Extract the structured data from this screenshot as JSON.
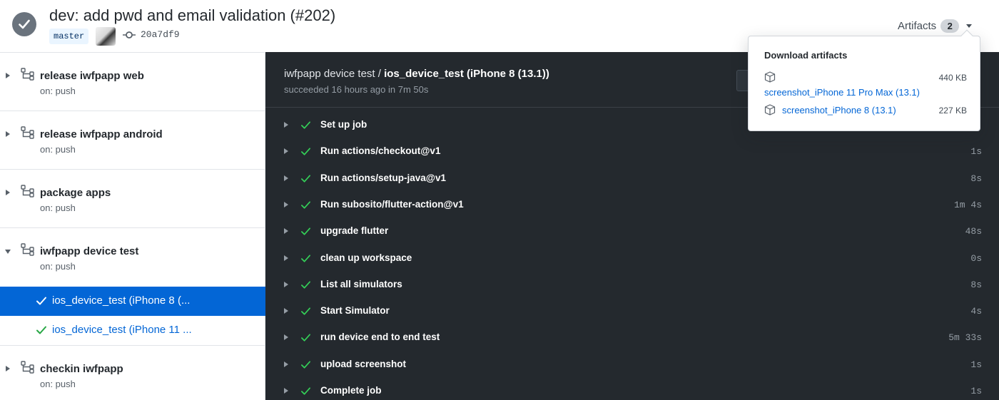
{
  "header": {
    "title": "dev: add pwd and email validation (#202)",
    "branch": "master",
    "commit_sha": "20a7df9",
    "artifacts_label": "Artifacts",
    "artifacts_count": "2"
  },
  "sidebar": {
    "workflows": [
      {
        "name": "release iwfpapp web",
        "trigger": "on: push",
        "expanded": false
      },
      {
        "name": "release iwfpapp android",
        "trigger": "on: push",
        "expanded": false
      },
      {
        "name": "package apps",
        "trigger": "on: push",
        "expanded": false
      },
      {
        "name": "iwfpapp device test",
        "trigger": "on: push",
        "expanded": true,
        "jobs": [
          {
            "name": "ios_device_test (iPhone 8 (...",
            "selected": true
          },
          {
            "name": "ios_device_test (iPhone 11 ...",
            "selected": false
          }
        ]
      },
      {
        "name": "checkin iwfpapp",
        "trigger": "on: push",
        "expanded": false
      }
    ]
  },
  "main": {
    "workflow_name": "iwfpapp device test",
    "separator": " / ",
    "job_name": "ios_device_test (iPhone 8 (13.1))",
    "status": "succeeded 16 hours ago in 7m 50s",
    "steps": [
      {
        "name": "Set up job",
        "time": ""
      },
      {
        "name": "Run actions/checkout@v1",
        "time": "1s"
      },
      {
        "name": "Run actions/setup-java@v1",
        "time": "8s"
      },
      {
        "name": "Run subosito/flutter-action@v1",
        "time": "1m 4s"
      },
      {
        "name": "upgrade flutter",
        "time": "48s"
      },
      {
        "name": "clean up workspace",
        "time": "0s"
      },
      {
        "name": "List all simulators",
        "time": "8s"
      },
      {
        "name": "Start Simulator",
        "time": "4s"
      },
      {
        "name": "run device end to end test",
        "time": "5m 33s"
      },
      {
        "name": "upload screenshot",
        "time": "1s"
      },
      {
        "name": "Complete job",
        "time": "1s"
      }
    ]
  },
  "artifacts_dropdown": {
    "title": "Download artifacts",
    "items": [
      {
        "name": "screenshot_iPhone 11 Pro Max (13.1)",
        "size": "440 KB"
      },
      {
        "name": "screenshot_iPhone 8 (13.1)",
        "size": "227 KB"
      }
    ]
  },
  "colors": {
    "accent": "#0366d6",
    "success": "#28a745",
    "dark_panel": "#24292e",
    "status_circle": "#6a737d"
  }
}
